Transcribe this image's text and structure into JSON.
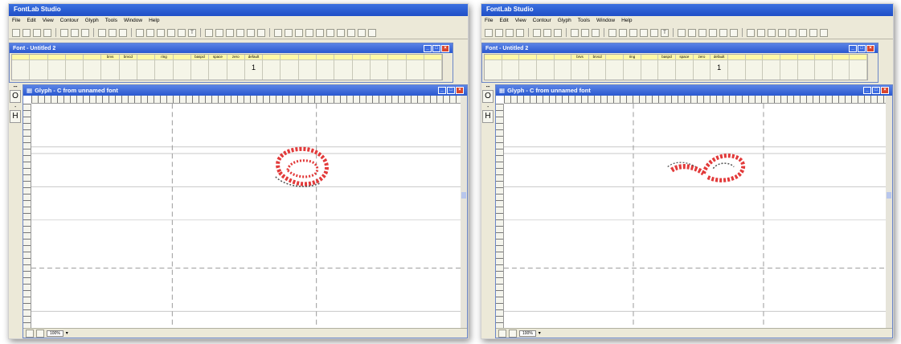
{
  "screenshots": [
    {
      "app_title": "FontLab Studio",
      "menu": [
        "File",
        "Edit",
        "View",
        "Contour",
        "Glyph",
        "Tools",
        "Window",
        "Help"
      ],
      "font_window_title": "Font - Untitled 2",
      "font_cells": [
        "",
        "",
        "",
        "",
        "",
        "brvs",
        "brvcd",
        "",
        "ring",
        "",
        "baspcl",
        "space",
        "zero",
        "default",
        "",
        "",
        "",
        "",
        "",
        "",
        "",
        "",
        "",
        ""
      ],
      "font_cell_value": "1",
      "glyph_window_title": "Glyph - C from unnamed font",
      "side_glyphs": [
        "O",
        "H"
      ],
      "zoom": "100%"
    },
    {
      "app_title": "FontLab Studio",
      "menu": [
        "File",
        "Edit",
        "View",
        "Contour",
        "Glyph",
        "Tools",
        "Window",
        "Help"
      ],
      "font_window_title": "Font - Untitled 2",
      "font_cells": [
        "",
        "",
        "",
        "",
        "",
        "brvs",
        "brvcd",
        "",
        "ring",
        "",
        "baspcl",
        "space",
        "zero",
        "default",
        "",
        "",
        "",
        "",
        "",
        "",
        "",
        ""
      ],
      "font_cell_value": "1",
      "glyph_window_title": "Glyph - C from unnamed font",
      "side_glyphs": [
        "O",
        "H"
      ],
      "zoom": "100%"
    }
  ],
  "colors": {
    "title_blue": "#2a58cf",
    "glyph_red": "#e23a3a",
    "chrome": "#ece9d8"
  }
}
